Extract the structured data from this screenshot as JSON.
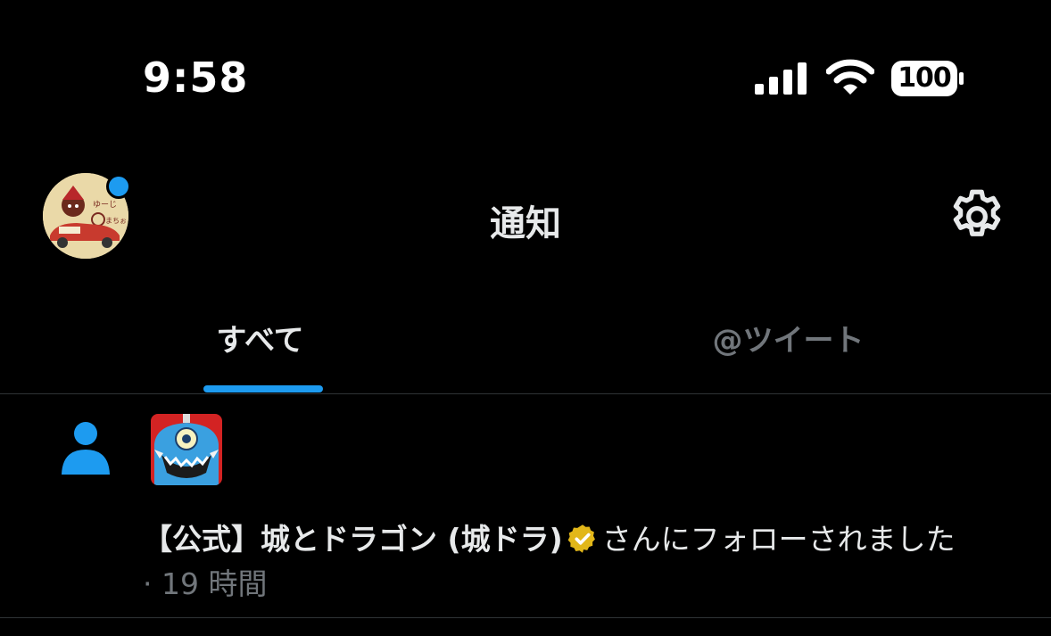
{
  "status_bar": {
    "time": "9:58",
    "battery_level": "100",
    "icons": [
      "cellular-signal-icon",
      "wifi-icon",
      "battery-icon"
    ]
  },
  "header": {
    "title": "通知",
    "settings_icon": "gear-icon",
    "has_unread_dot": true
  },
  "tabs": [
    {
      "label": "すべて",
      "active": true
    },
    {
      "label": "@ツイート",
      "active": false
    }
  ],
  "notifications": [
    {
      "type": "follow",
      "icon": "person-icon",
      "account_name": "【公式】城とドラゴン (城ドラ)",
      "verified": true,
      "action_text": "さんにフォローされました",
      "time": "· 19 時間"
    }
  ],
  "colors": {
    "background": "#000000",
    "accent": "#1d9bf0",
    "text_primary": "#e7e9ea",
    "text_secondary": "#71767b",
    "divider": "#2f3336",
    "verified_gold": "#e2b719"
  }
}
